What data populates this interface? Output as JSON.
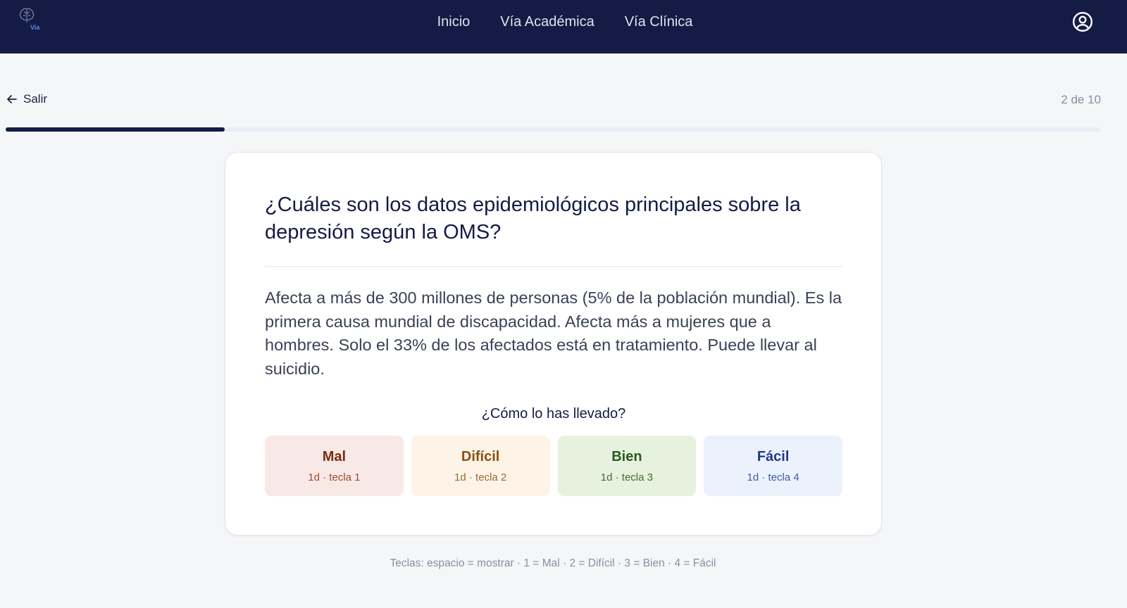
{
  "header": {
    "logo_text": "Via",
    "nav": [
      "Inicio",
      "Vía Académica",
      "Vía Clínica"
    ]
  },
  "session": {
    "exit_label": "Salir",
    "counter": "2 de 10",
    "progress_fraction": 0.2
  },
  "card": {
    "question": "¿Cuáles son los datos epidemiológicos principales sobre la depresión según la OMS?",
    "answer": "Afecta a más de 300 millones de personas (5% de la población mundial). Es la primera causa mundial de discapacidad. Afecta más a mujeres que a hombres. Solo el 33% de los afectados está en tratamiento. Puede llevar al suicidio.",
    "rating_prompt": "¿Cómo lo has llevado?",
    "ratings": [
      {
        "label": "Mal",
        "sub": "1d · tecla 1"
      },
      {
        "label": "Difícil",
        "sub": "1d · tecla 2"
      },
      {
        "label": "Bien",
        "sub": "1d · tecla 3"
      },
      {
        "label": "Fácil",
        "sub": "1d · tecla 4"
      }
    ]
  },
  "footer_hint": "Teclas: espacio = mostrar · 1 = Mal · 2 = Difícil · 3 = Bien · 4 = Fácil",
  "colors": {
    "header_bg": "#141b45",
    "accent": "#4f8cf0"
  }
}
